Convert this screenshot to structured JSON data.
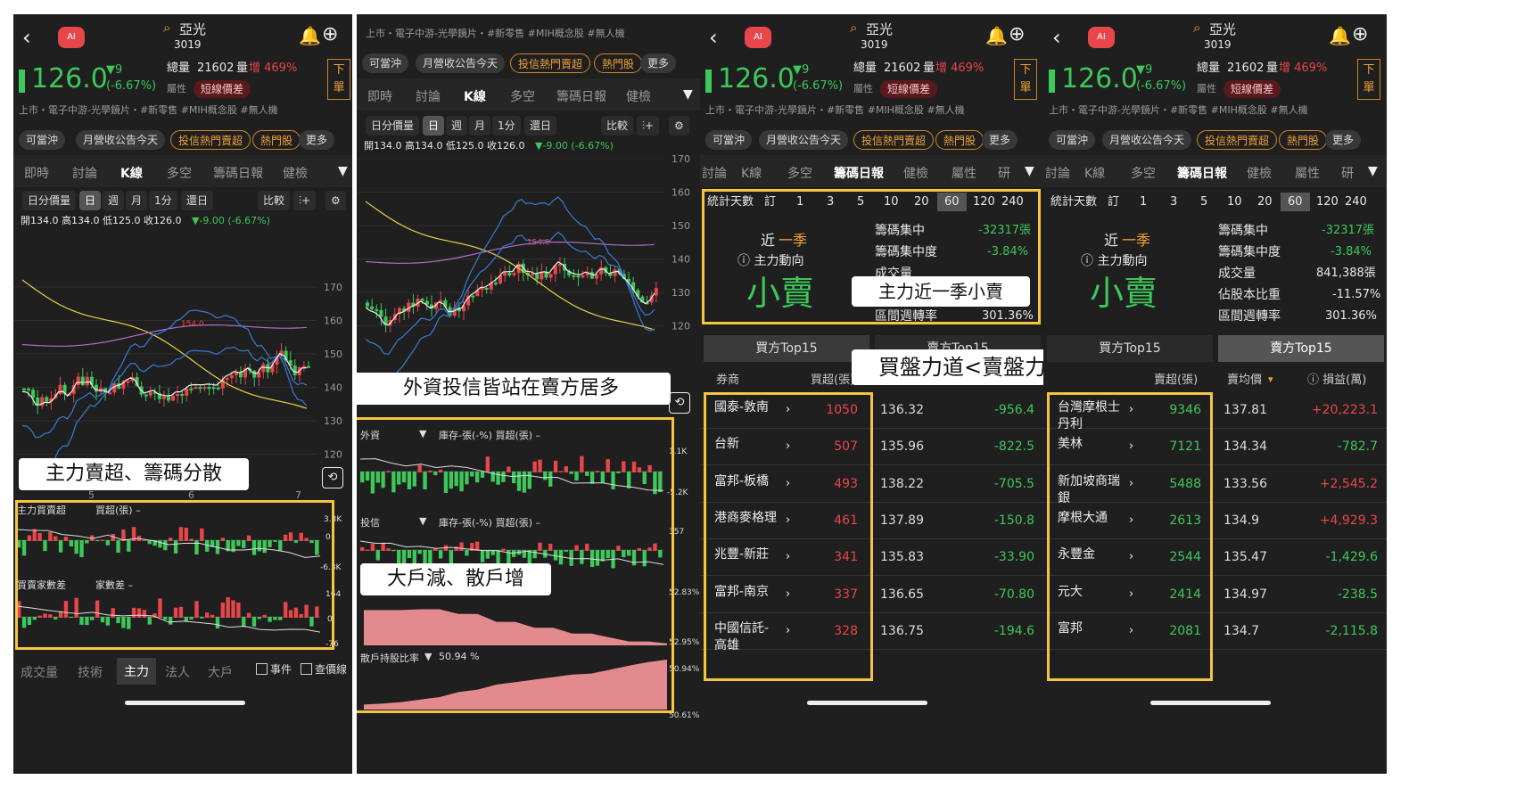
{
  "stock": {
    "name": "亞光",
    "code": "3019",
    "price": "126.0",
    "change": "▼9",
    "change_pct": "(-6.67%)",
    "volume_label": "總量",
    "volume": "21602",
    "volume_unit": "量",
    "volume_increase": "增 469%",
    "attr_label": "屬性",
    "attr_badge": "短線價差",
    "tags": "上市・電子中游-光學鏡片・#新零售 #MIH概念股 #無人機",
    "order_button": "下單"
  },
  "quick_pills": [
    "可當沖",
    "月營收公告今天",
    "投信熱門賣超",
    "熱門股",
    "更多"
  ],
  "tabs_main": [
    "即時",
    "討論",
    "K線",
    "多空",
    "籌碼日報",
    "健檢"
  ],
  "tabs_chip": [
    "討論",
    "K線",
    "多空",
    "籌碼日報",
    "健檢",
    "屬性",
    "研"
  ],
  "kline": {
    "period_options": [
      "日分價量",
      "日",
      "週",
      "月",
      "1分",
      "還日"
    ],
    "compare": "比較",
    "ohlc": "開134.0 高134.0 低125.0 收126.0",
    "ohlc_change": "▼-9.00 (-6.67%)",
    "y_ticks": [
      "170",
      "160",
      "150",
      "140",
      "130",
      "120"
    ],
    "hi_label": "154.0",
    "x_ticks": [
      "5",
      "6",
      "7"
    ]
  },
  "chip_panels": {
    "main_force": "主力買賣超",
    "main_force_sub": "買超(張) –",
    "main_force_axis": [
      "3.3K",
      "0",
      "-6.3K"
    ],
    "buyer_seller": "買賣家數差",
    "buyer_seller_sub": "家數差 –",
    "buyer_seller_axis": [
      "164",
      "0",
      "-76"
    ],
    "foreign": "外資",
    "foreign_sub": "庫存-張(-%)  買超(張) –",
    "foreign_axis": [
      "1.1K",
      "0",
      "-5.2K"
    ],
    "trust": "投信",
    "trust_sub": "庫存-張(-%)  買超(張) –",
    "trust_axis": [
      "357",
      "0"
    ],
    "big_axis": [
      "52.83%",
      "52.95%"
    ],
    "retail": "散戶持股比率",
    "retail_value": "50.94 %",
    "retail_axis": [
      "50.94%",
      "50.61%"
    ]
  },
  "bottom_tabs": [
    "成交量",
    "技術",
    "主力",
    "法人",
    "大戶"
  ],
  "bottom_checks": [
    "事件",
    "查價線"
  ],
  "callouts": {
    "c1": "主力賣超、籌碼分散",
    "c2": "外資投信皆站在賣方居多",
    "c3": "大戶減、散戶增",
    "c4": "主力近一季小賣",
    "c5": "買盤力道<賣盤力道"
  },
  "chip_stats": {
    "days_label": "統計天數",
    "custom": "訂",
    "days": [
      "1",
      "3",
      "5",
      "10",
      "20",
      "60",
      "120",
      "240"
    ],
    "selected_days": "60",
    "period_pre": "近",
    "period_hl": "一季",
    "direction_label": "ⓘ 主力動向",
    "direction_value": "小賣",
    "rows": [
      {
        "label": "籌碼集中",
        "value": "-32317張"
      },
      {
        "label": "籌碼集中度",
        "value": "-3.84%"
      },
      {
        "label": "成交量",
        "value": "841,388張"
      },
      {
        "label": "佔股本比重",
        "value": "-11.57%"
      },
      {
        "label": "區間週轉率",
        "value": "301.36%"
      }
    ]
  },
  "top15": {
    "buy_tab": "買方Top15",
    "sell_tab": "賣方Top15",
    "buy_headers": [
      "券商",
      "買超(張)"
    ],
    "sell_headers": [
      "賣超(張)",
      "賣均價",
      "ⓘ 損益(萬)"
    ],
    "buy_rows": [
      {
        "broker": "國泰-敦南",
        "qty": "1050",
        "avg": "136.32",
        "pnl": "-956.4"
      },
      {
        "broker": "台新",
        "qty": "507",
        "avg": "135.96",
        "pnl": "-822.5"
      },
      {
        "broker": "富邦-板橋",
        "qty": "493",
        "avg": "138.22",
        "pnl": "-705.5"
      },
      {
        "broker": "港商麥格理",
        "qty": "461",
        "avg": "137.89",
        "pnl": "-150.8"
      },
      {
        "broker": "兆豐-新莊",
        "qty": "341",
        "avg": "135.83",
        "pnl": "-33.90"
      },
      {
        "broker": "富邦-南京",
        "qty": "337",
        "avg": "136.65",
        "pnl": "-70.80"
      },
      {
        "broker": "中國信託-高雄",
        "qty": "328",
        "avg": "136.75",
        "pnl": "-194.6"
      }
    ],
    "sell_rows": [
      {
        "broker": "台灣摩根士丹利",
        "qty": "9346",
        "avg": "137.81",
        "pnl": "+20,223.1"
      },
      {
        "broker": "美林",
        "qty": "7121",
        "avg": "134.34",
        "pnl": "-782.7"
      },
      {
        "broker": "新加坡商瑞銀",
        "qty": "5488",
        "avg": "133.56",
        "pnl": "+2,545.2"
      },
      {
        "broker": "摩根大通",
        "qty": "2613",
        "avg": "134.9",
        "pnl": "+4,929.3"
      },
      {
        "broker": "永豐金",
        "qty": "2544",
        "avg": "135.47",
        "pnl": "-1,429.6"
      },
      {
        "broker": "元大",
        "qty": "2414",
        "avg": "134.97",
        "pnl": "-238.5"
      },
      {
        "broker": "富邦",
        "qty": "2081",
        "avg": "134.7",
        "pnl": "-2,115.8"
      }
    ]
  },
  "colors": {
    "up": "#e8464b",
    "down": "#3ec75a",
    "accent": "#f2a23a",
    "box": "#f5c542"
  }
}
